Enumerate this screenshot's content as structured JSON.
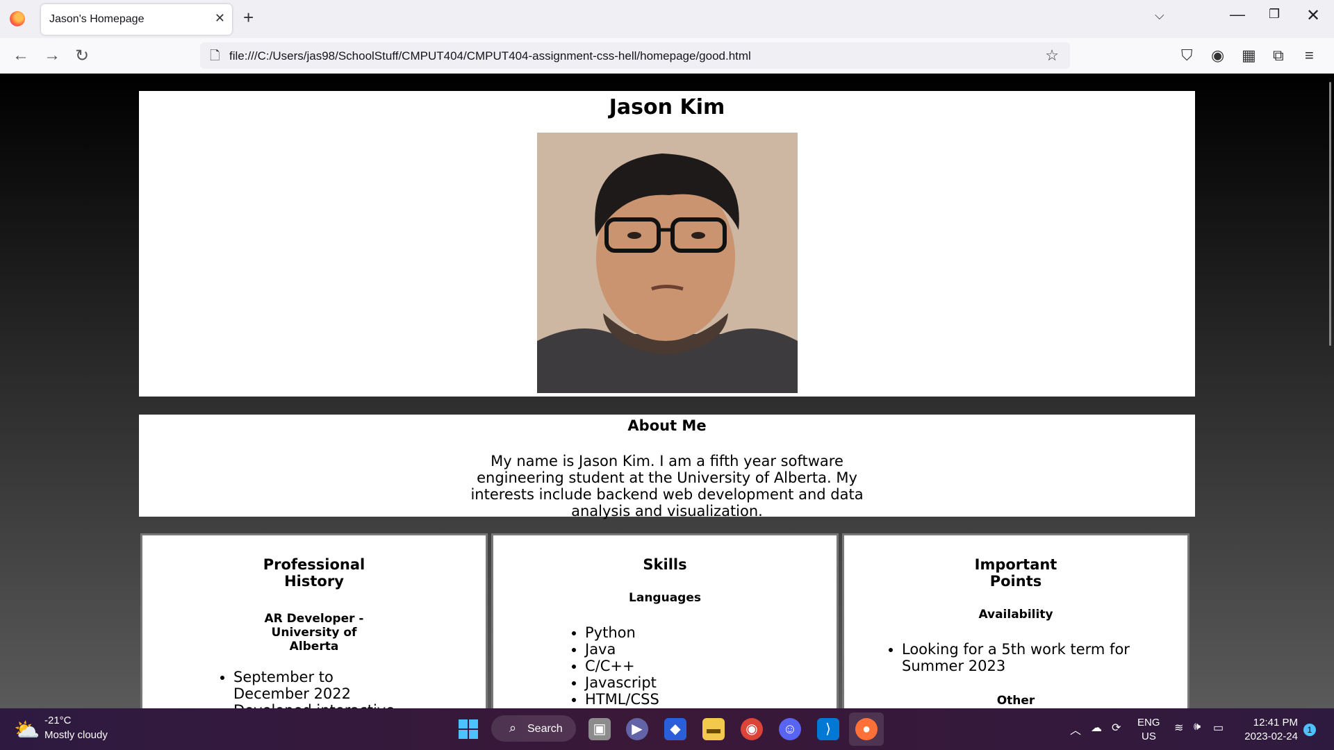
{
  "browser": {
    "tab_title": "Jason's Homepage",
    "url": "file:///C:/Users/jas98/SchoolStuff/CMPUT404/CMPUT404-assignment-css-hell/homepage/good.html"
  },
  "page": {
    "name": "Jason Kim",
    "about_title": "About Me",
    "about_text": "My name is Jason Kim. I am a fifth year software engineering student at the University of Alberta. My interests include backend web development and data analysis and visualization.",
    "professional": {
      "title_line1": "Professional",
      "title_line2": "History",
      "job_line1": "AR Developer -",
      "job_line2": "University of",
      "job_line3": "Alberta",
      "items": [
        "September to December 2022",
        "Developed interactive"
      ]
    },
    "skills": {
      "title": "Skills",
      "subtitle": "Languages",
      "items": [
        "Python",
        "Java",
        "C/C++",
        "Javascript",
        "HTML/CSS"
      ]
    },
    "important": {
      "title_line1": "Important",
      "title_line2": "Points",
      "subtitle": "Availability",
      "items": [
        "Looking for a 5th work term for Summer 2023"
      ],
      "other": "Other"
    }
  },
  "taskbar": {
    "temp": "-21°C",
    "weather": "Mostly cloudy",
    "search_label": "Search",
    "lang1": "ENG",
    "lang2": "US",
    "time": "12:41 PM",
    "date": "2023-02-24",
    "notifications": "1"
  }
}
